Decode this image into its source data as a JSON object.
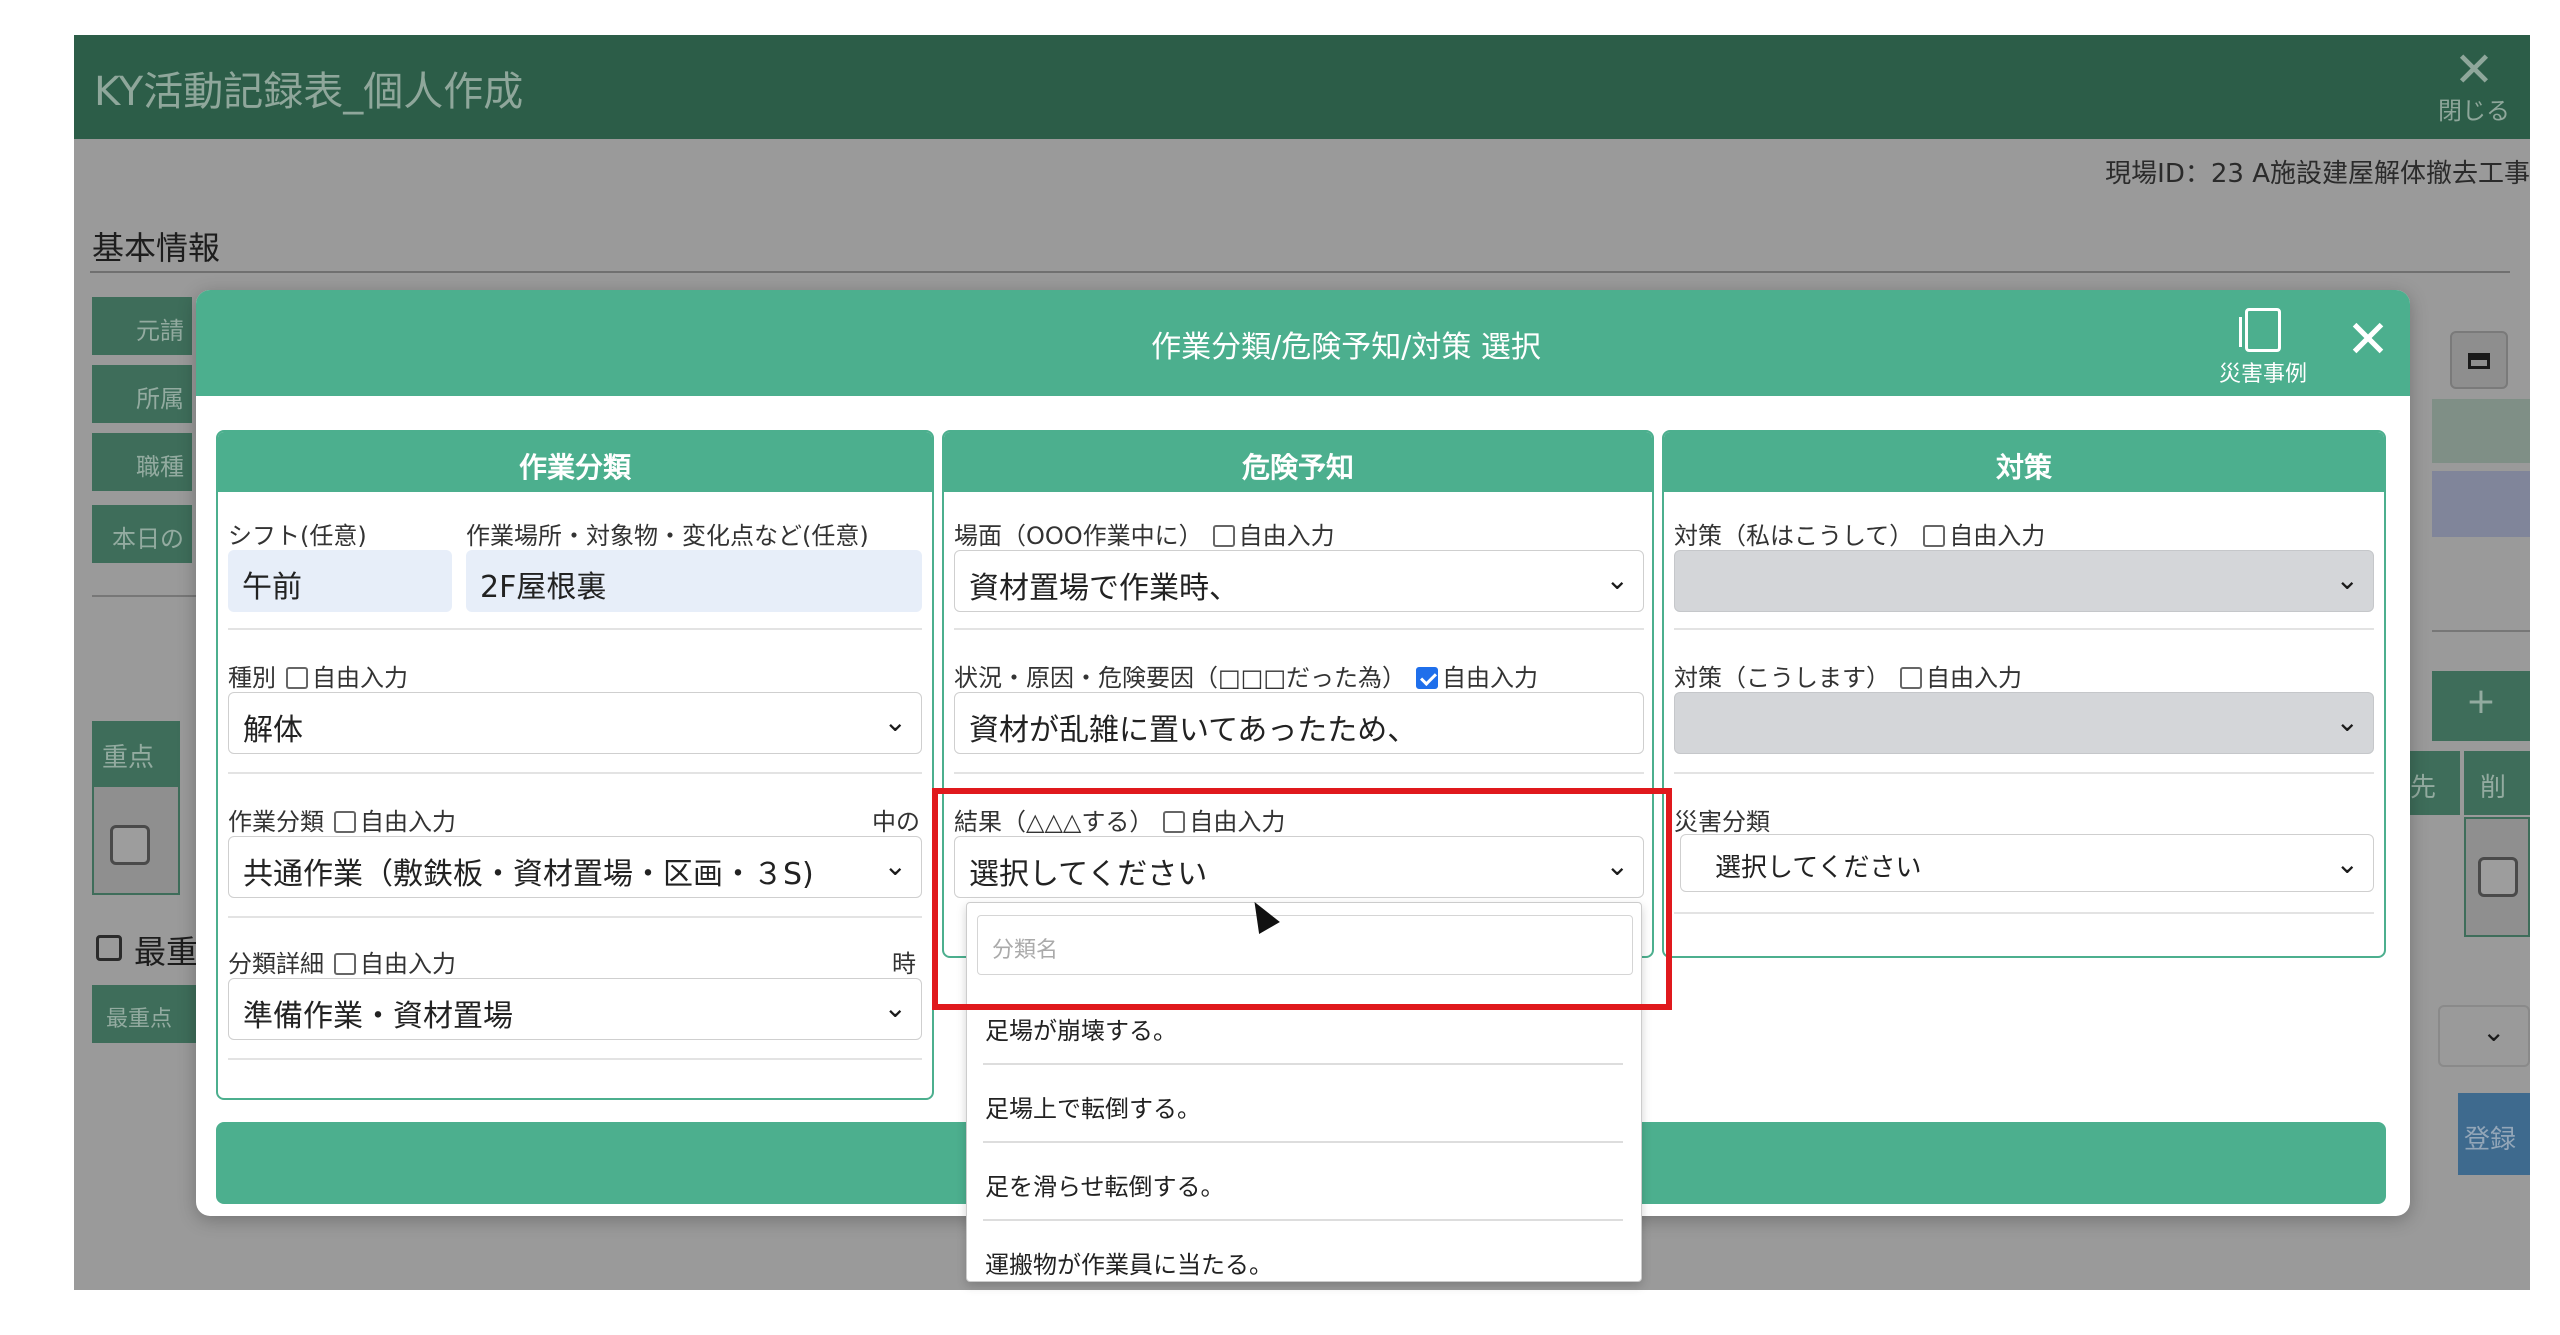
{
  "app": {
    "title": "KY活動記録表_個人作成",
    "close_x": "✕",
    "close_label": "閉じる",
    "site_id": "現場ID：23 A施設建屋解体撤去工事",
    "basic_info": "基本情報",
    "side_labels": [
      "元請",
      "所属",
      "職種",
      "本日の"
    ],
    "table_head": "重点",
    "most_important_label": "最重",
    "most_important_button": "最重点",
    "add_button": "+",
    "table_head_right": [
      "先",
      "削"
    ],
    "register_button": "登録"
  },
  "modal": {
    "title": "作業分類/危険予知/対策 選択",
    "case_label": "災害事例",
    "close_x": "✕",
    "columns": {
      "work": {
        "header": "作業分類",
        "shift_label": "シフト(任意)",
        "shift_value": "午前",
        "place_label": "作業場所・対象物・変化点など(任意)",
        "place_value": "2F屋根裏",
        "type_label": "種別",
        "type_free": "自由入力",
        "type_value": "解体",
        "category_label": "作業分類",
        "category_free": "自由入力",
        "category_suffix": "中の",
        "category_value": "共通作業（敷鉄板・資材置場・区画・３S)",
        "detail_label": "分類詳細",
        "detail_free": "自由入力",
        "detail_suffix": "時",
        "detail_value": "準備作業・資材置場"
      },
      "danger": {
        "header": "危険予知",
        "scene_label": "場面（OOO作業中に）",
        "scene_free": "自由入力",
        "scene_value": "資材置場で作業時、",
        "cause_label": "状況・原因・危険要因（□□□だった為）",
        "cause_free": "自由入力",
        "cause_checked": true,
        "cause_value": "資材が乱雑に置いてあったため、",
        "result_label": "結果（△△△する）",
        "result_free": "自由入力",
        "result_value": "選択してください"
      },
      "measure": {
        "header": "対策",
        "measure1_label": "対策（私はこうして）",
        "measure1_free": "自由入力",
        "measure2_label": "対策（こうします）",
        "measure2_free": "自由入力",
        "disaster_label": "災害分類",
        "disaster_value": "選択してください"
      }
    },
    "dropdown": {
      "search_placeholder": "分類名",
      "options": [
        "足場が崩壊する。",
        "足場上で転倒する。",
        "足を滑らせ転倒する。",
        "運搬物が作業員に当たる。"
      ]
    }
  },
  "colors": {
    "accent": "#4caf8e",
    "header_dark": "#2c5d48",
    "highlight": "#e0191d",
    "checkbox_on": "#1f6feb"
  },
  "icons": [
    "close-icon",
    "document-icon",
    "chevron-down-icon",
    "calendar-icon",
    "mouse-cursor-icon"
  ]
}
